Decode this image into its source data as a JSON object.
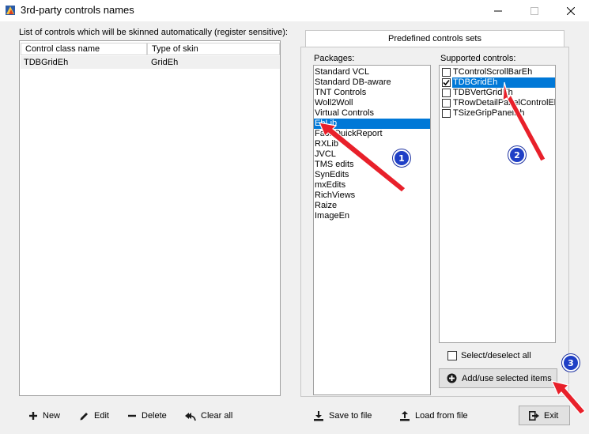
{
  "window": {
    "title": "3rd-party controls names"
  },
  "left": {
    "label": "List of controls which will be skinned automatically (register sensitive):",
    "columns": [
      "Control class name",
      "Type of skin"
    ],
    "rows": [
      {
        "class_name": "TDBGridEh",
        "skin": "GridEh"
      }
    ]
  },
  "right": {
    "tab_label": "Predefined controls sets",
    "packages_label": "Packages:",
    "packages": [
      "Standard VCL",
      "Standard DB-aware",
      "TNT Controls",
      "Woll2Woll",
      "Virtual Controls",
      "EhLib",
      "Fast/QuickReport",
      "RXLib",
      "JVCL",
      "TMS edits",
      "SynEdits",
      "mxEdits",
      "RichViews",
      "Raize",
      "ImageEn"
    ],
    "selected_package": "EhLib",
    "supported_label": "Supported controls:",
    "supported": [
      {
        "label": "TControlScrollBarEh",
        "checked": false
      },
      {
        "label": "TDBGridEh",
        "checked": true
      },
      {
        "label": "TDBVertGridEh",
        "checked": false
      },
      {
        "label": "TRowDetailPanelControlEh",
        "checked": false
      },
      {
        "label": "TSizeGripPanelEh",
        "checked": false
      }
    ],
    "selected_supported": "TDBGridEh",
    "select_all_label": "Select/deselect all",
    "add_button_label": "Add/use selected items"
  },
  "toolbar": {
    "new_label": "New",
    "edit_label": "Edit",
    "delete_label": "Delete",
    "clear_label": "Clear all",
    "save_label": "Save to file",
    "load_label": "Load from file",
    "exit_label": "Exit"
  },
  "annotations": {
    "badge1": "1",
    "badge2": "2",
    "badge3": "3"
  },
  "colors": {
    "selection": "#0078d7",
    "annotation_arrow": "#e8202a",
    "badge": "#1f3fc6"
  }
}
